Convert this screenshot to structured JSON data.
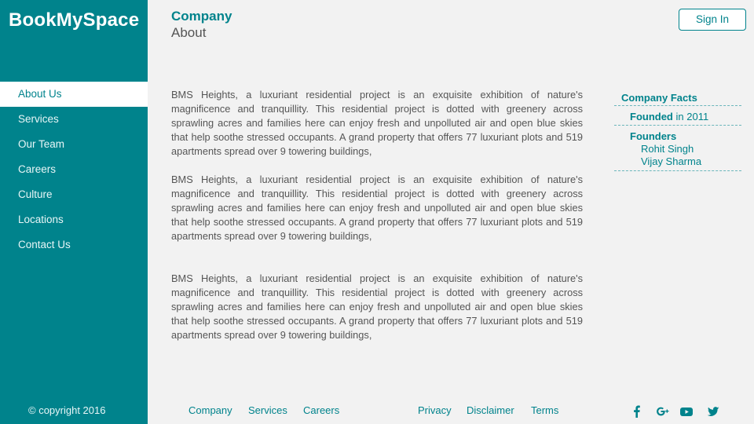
{
  "brand": "BookMySpace",
  "header": {
    "title": "Company",
    "subtitle": "About",
    "signin_label": "Sign In"
  },
  "sidebar": {
    "items": [
      {
        "label": "About Us"
      },
      {
        "label": "Services"
      },
      {
        "label": "Our Team"
      },
      {
        "label": "Careers"
      },
      {
        "label": "Culture"
      },
      {
        "label": "Locations"
      },
      {
        "label": "Contact Us"
      }
    ],
    "active_index": 0,
    "copyright": "© copyright 2016"
  },
  "main": {
    "paragraphs": [
      "BMS Heights, a luxuriant residential project is an exquisite exhibition of nature's magnificence and tranquillity. This residential project is dotted with greenery across sprawling acres and families here can enjoy fresh and unpolluted air and open blue skies that help soothe stressed occupants. A grand property that offers 77 luxuriant plots and 519 apartments spread over 9 towering buildings,",
      "BMS Heights, a luxuriant residential project is an exquisite exhibition of nature's magnificence and tranquillity. This residential project is dotted with greenery across sprawling acres and families here can enjoy fresh and unpolluted air and open blue skies that help soothe stressed occupants. A grand property that offers 77 luxuriant plots and 519 apartments spread over 9 towering buildings,",
      "BMS Heights, a luxuriant residential project is an exquisite exhibition of nature's magnificence and tranquillity. This residential project is dotted with greenery across sprawling acres and families here can enjoy fresh and unpolluted air and open blue skies that help soothe stressed occupants. A grand property that offers 77 luxuriant plots and 519 apartments spread over 9 towering buildings,"
    ]
  },
  "facts": {
    "title": "Company Facts",
    "founded_label": "Founded",
    "founded_value": "in 2011",
    "founders_label": "Founders",
    "founders": [
      "Rohit Singh",
      "Vijay Sharma"
    ]
  },
  "footer": {
    "links_left": [
      "Company",
      "Services",
      "Careers"
    ],
    "links_right": [
      "Privacy",
      "Disclaimer",
      "Terms"
    ],
    "social_icons": [
      "facebook-icon",
      "google-plus-icon",
      "youtube-icon",
      "twitter-icon"
    ]
  },
  "colors": {
    "accent": "#00838c",
    "background": "#f2f2f2",
    "text": "#555555"
  }
}
